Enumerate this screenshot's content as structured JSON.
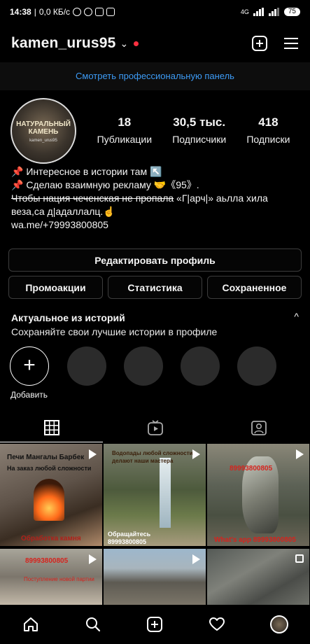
{
  "status": {
    "time": "14:38",
    "network_speed": "0,0 КБ/с",
    "signal": "4G",
    "battery": "75"
  },
  "header": {
    "username": "kamen_urus95",
    "chevron": "⌄",
    "new_post_icon": "plus-square-icon",
    "menu_icon": "hamburger-icon"
  },
  "pro_panel": {
    "label": "Смотреть профессиональную панель"
  },
  "avatar": {
    "ring_text": "НАТУРАЛЬНЫЙ КАМЕНЬ",
    "caption": "kamen_urus95"
  },
  "stats": [
    {
      "value": "18",
      "label": "Публикации"
    },
    {
      "value": "30,5 тыс.",
      "label": "Подписчики"
    },
    {
      "value": "418",
      "label": "Подписки"
    }
  ],
  "bio": {
    "line1": "📌 Интересное в истории там ↖️",
    "line2": "📌 Сделаю взаимную рекламу 🤝《95》.",
    "line3_strike": "Чтобы нация чеченская не пропала",
    "line3_rest": " «Г|арч|» аьлла хила",
    "line4": "веза,са д|адаллалц.☝️",
    "link": "wa.me/+79993800805"
  },
  "buttons": {
    "edit_profile": "Редактировать профиль",
    "promo": "Промоакции",
    "stats": "Статистика",
    "saved": "Сохраненное"
  },
  "highlights": {
    "title": "Актуальное из историй",
    "subtitle": "Сохраняйте свои лучшие истории в профиле",
    "caret": "^",
    "add_label": "Добавить"
  },
  "posts": [
    {
      "caption_top": "Печи Мангалы Барбек",
      "caption_mid": "На заказ любой сложности",
      "caption_bottom": "Обработка камня"
    },
    {
      "caption_top": "Водопады любой сложности делают наши мастера",
      "caption_bottom": "Обращайтесь 89993800805"
    },
    {
      "caption_top": "89993800805",
      "caption_bottom": "What's app 89993800805"
    },
    {
      "caption_top": "89993800805",
      "caption_bottom": "Поступление новой партии"
    },
    {
      "caption_top": ""
    },
    {
      "caption_top": ""
    }
  ],
  "colors": {
    "accent_link": "#3d9bf5",
    "notif_dot": "#ff3040",
    "background": "#000000"
  }
}
